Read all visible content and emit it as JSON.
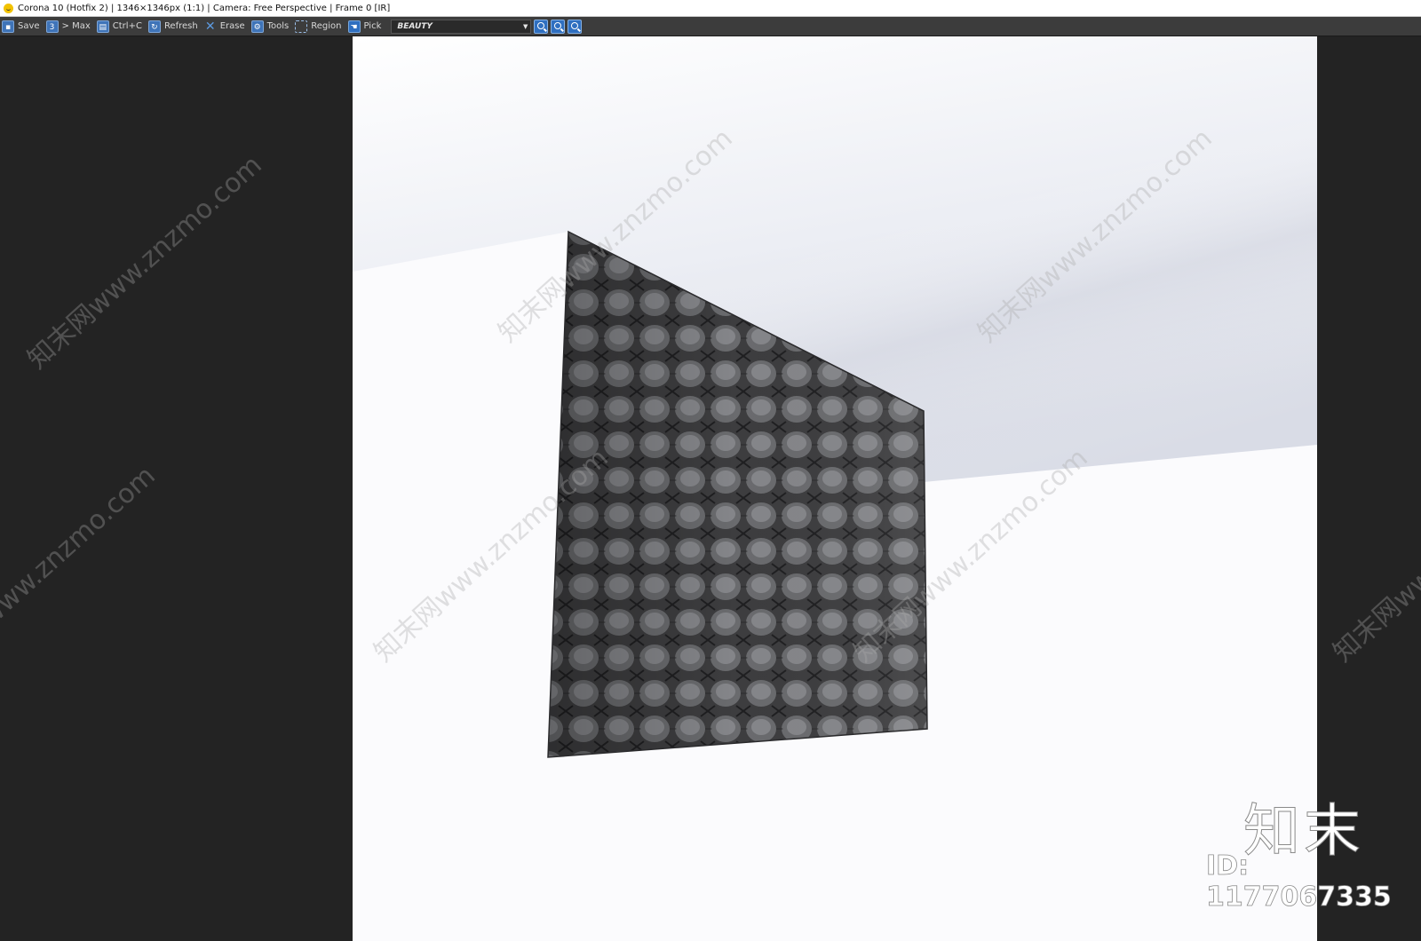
{
  "window": {
    "title": "Corona 10 (Hotfix 2) | 1346×1346px (1:1) | Camera: Free Perspective | Frame 0 [IR]"
  },
  "toolbar": {
    "save": "Save",
    "to_max": "> Max",
    "copy": "Ctrl+C",
    "refresh": "Refresh",
    "erase": "Erase",
    "tools": "Tools",
    "region": "Region",
    "pick": "Pick",
    "render_pass": "BEAUTY",
    "zoom_in": "zoom-in",
    "zoom_out": "zoom-out",
    "zoom_fit": "zoom-fit"
  },
  "watermark": {
    "text": "知末网www.znzmo.com",
    "logo": "知末",
    "id": "ID: 1177067335"
  },
  "colors": {
    "accent": "#3f74b8",
    "background": "#232323",
    "toolbar": "#3c3c3c"
  }
}
